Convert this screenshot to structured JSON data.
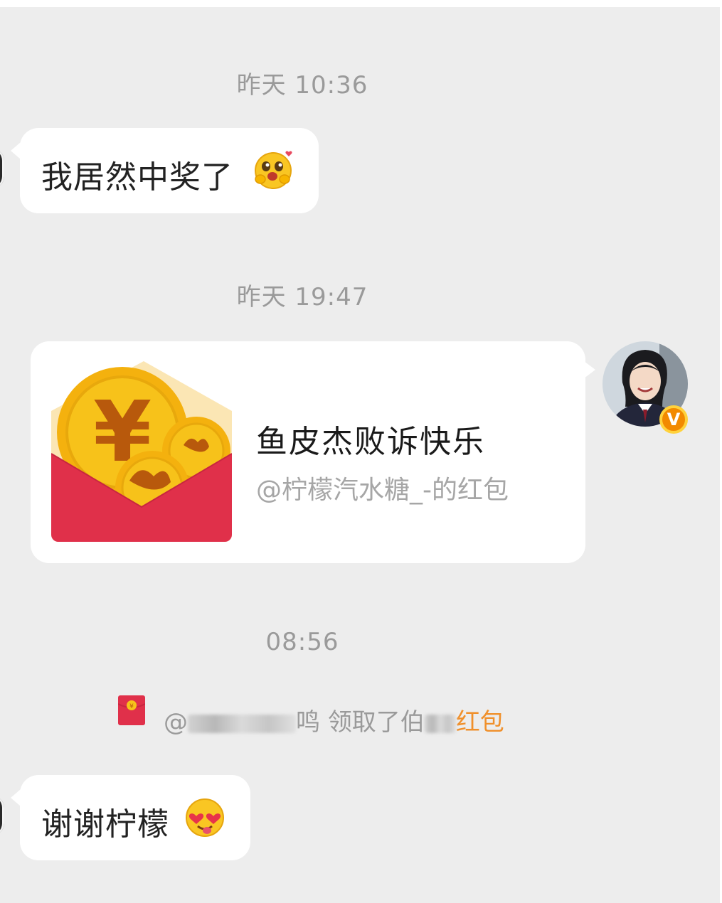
{
  "messages": {
    "ts1": "昨天 10:36",
    "msg1_text": "我居然中奖了",
    "msg1_emoji": "hug-emoji",
    "ts2": "昨天 19:47",
    "red_packet": {
      "title": "鱼皮杰败诉快乐",
      "subtitle": "@柠檬汽水糖_-的红包",
      "icon": "red-envelope-coins-icon",
      "sender_badge": "V"
    },
    "ts3": "08:56",
    "notice": {
      "at": "@",
      "name_suffix": "鸣",
      "claimed": "领取了",
      "owner_prefix": "伯",
      "link": "红包",
      "link_color": "#f0902b"
    },
    "msg2_text": "谢谢柠檬",
    "msg2_emoji": "heart-eyes-tongue-emoji"
  },
  "colors": {
    "background": "#ededed",
    "bubble": "#ffffff",
    "envelope_red": "#e0304a",
    "coin_gold": "#f7c21a",
    "verified_badge": "#f28a00"
  }
}
